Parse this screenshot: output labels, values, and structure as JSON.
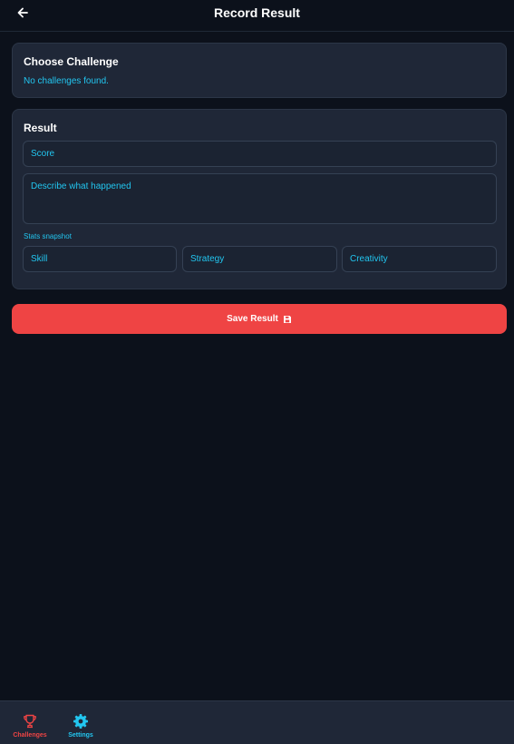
{
  "header": {
    "title": "Record Result",
    "back_icon": "arrow-left-icon"
  },
  "choose_challenge": {
    "heading": "Choose Challenge",
    "empty_message": "No challenges found."
  },
  "result": {
    "heading": "Result",
    "score_placeholder": "Score",
    "score_value": "",
    "describe_placeholder": "Describe what happened",
    "describe_value": "",
    "stats_label": "Stats snapshot",
    "stats": {
      "skill_placeholder": "Skill",
      "strategy_placeholder": "Strategy",
      "creativity_placeholder": "Creativity"
    }
  },
  "save_button": {
    "label": "Save Result",
    "icon": "floppy-disk-icon"
  },
  "bottom_nav": {
    "items": [
      {
        "label": "Challenges",
        "icon": "trophy-icon",
        "active": true
      },
      {
        "label": "Settings",
        "icon": "gear-icon",
        "active": false
      }
    ]
  },
  "colors": {
    "background": "#0c111b",
    "card": "#1f2737",
    "accent_cyan": "#22c6f0",
    "accent_red": "#ef4444",
    "text": "#ffffff"
  }
}
